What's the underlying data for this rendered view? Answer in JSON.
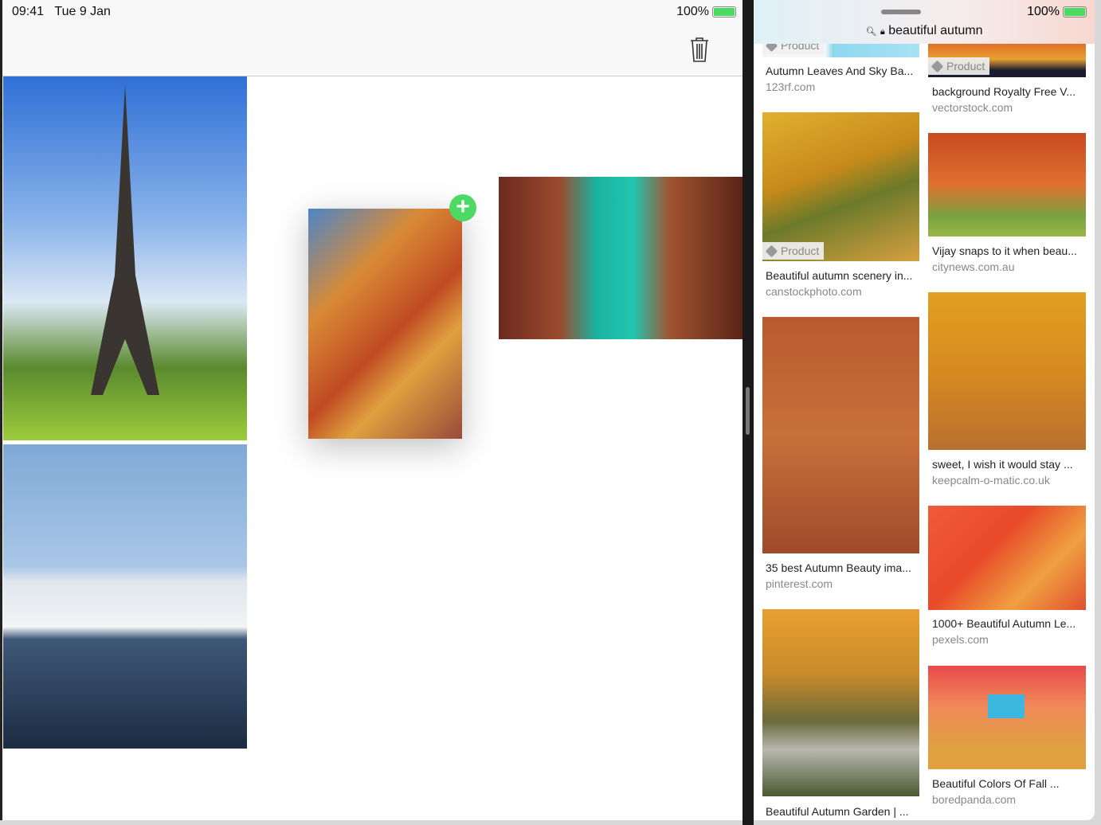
{
  "status_left": {
    "time": "09:41",
    "date": "Tue 9 Jan",
    "battery": "100%"
  },
  "status_right": {
    "battery": "100%"
  },
  "left_app": {
    "toolbar": {
      "trash_icon": "trash-icon"
    },
    "photos": [
      "Eiffel Tower",
      "Iceberg",
      "Autumn forest path (dragging)",
      "Venice canal"
    ],
    "add_badge": "+",
    "add_color": "#4cd964"
  },
  "safari": {
    "url": "beautiful autumn",
    "tag": "Product",
    "col1": [
      {
        "title": "Autumn Leaves And Sky Ba...",
        "source": "123rf.com",
        "tag": true
      },
      {
        "title": "Beautiful autumn scenery in...",
        "source": "canstockphoto.com",
        "tag": true
      },
      {
        "title": "35 best Autumn Beauty ima...",
        "source": "pinterest.com"
      },
      {
        "title": "Beautiful Autumn Garden | ...",
        "source": ""
      }
    ],
    "col2": [
      {
        "title": "background Royalty Free V...",
        "source": "vectorstock.com",
        "tag": true
      },
      {
        "title": "Vijay snaps to it when beau...",
        "source": "citynews.com.au"
      },
      {
        "title": "sweet, I wish it would stay ...",
        "source": "keepcalm-o-matic.co.uk"
      },
      {
        "title": "1000+ Beautiful Autumn Le...",
        "source": "pexels.com"
      },
      {
        "title": "Beautiful Colors Of Fall ...",
        "source": "boredpanda.com"
      }
    ]
  }
}
